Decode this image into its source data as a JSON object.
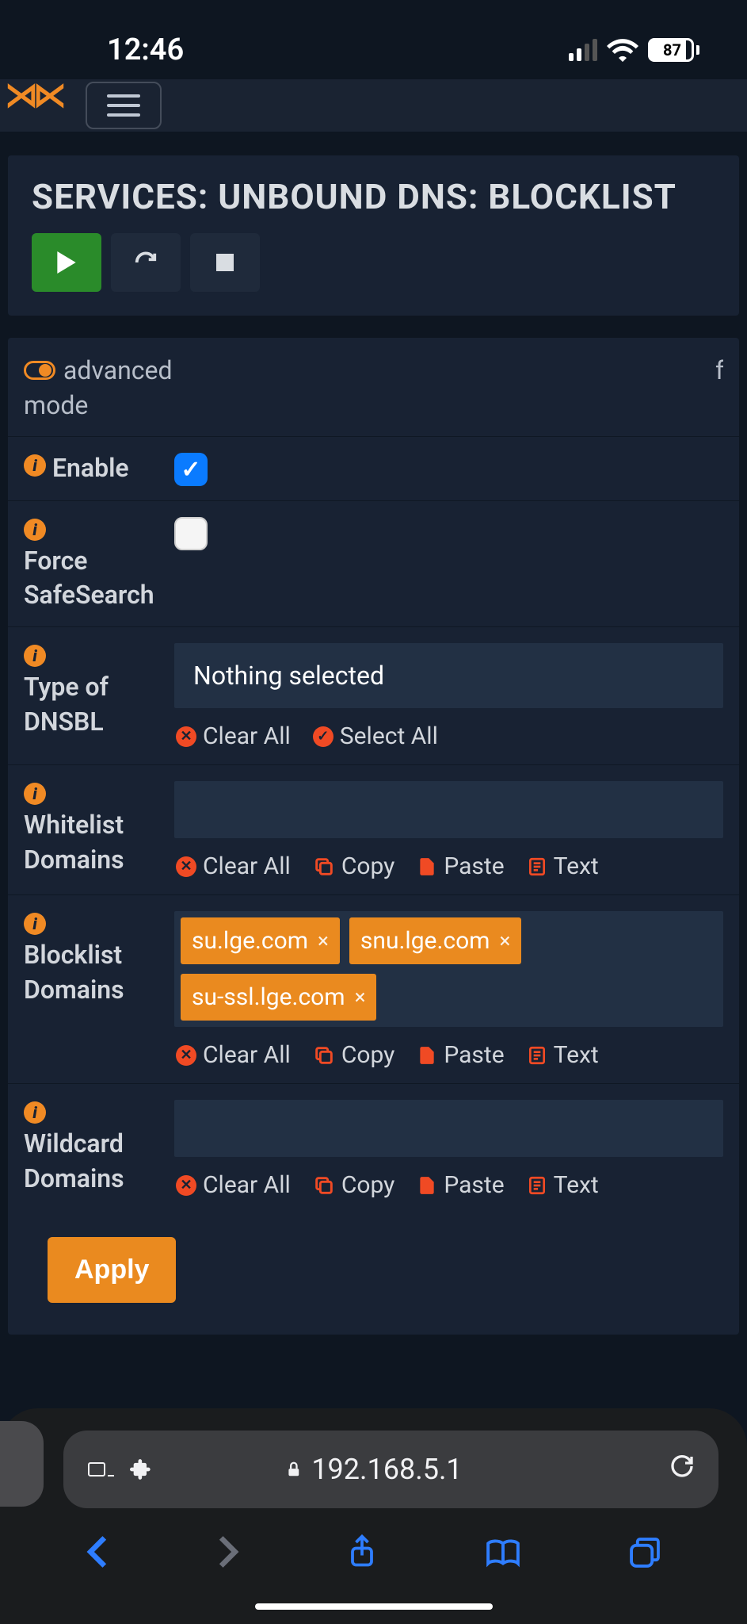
{
  "status": {
    "time": "12:46",
    "battery": "87"
  },
  "page": {
    "title": "SERVICES: UNBOUND DNS: BLOCKLIST"
  },
  "adv": {
    "line1": "advanced",
    "line2": "mode",
    "right": "f"
  },
  "labels": {
    "enable": "Enable",
    "safesearch": "Force SafeSearch",
    "dnsbl_type": "Type of DNSBL",
    "whitelist": "Whitelist Domains",
    "blocklist": "Blocklist Domains",
    "wildcard": "Wildcard Domains"
  },
  "fields": {
    "enable_checked": true,
    "safesearch_checked": false,
    "dnsbl_selected": "Nothing selected",
    "blocklist_tokens": [
      "su.lge.com",
      "snu.lge.com",
      "su-ssl.lge.com"
    ]
  },
  "actions": {
    "clear_all": "Clear All",
    "select_all": "Select All",
    "copy": "Copy",
    "paste": "Paste",
    "text": "Text",
    "apply": "Apply"
  },
  "browser": {
    "url": "192.168.5.1"
  }
}
